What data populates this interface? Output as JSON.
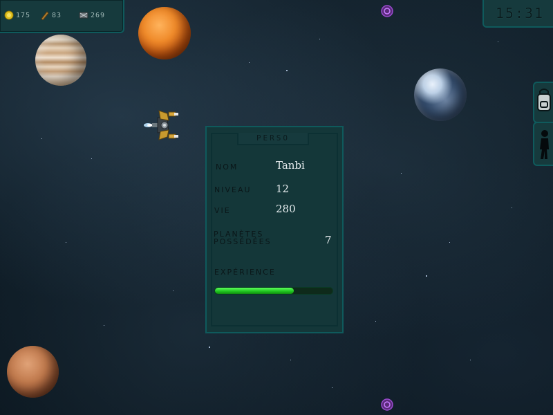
{
  "resources": [
    {
      "icon": "gold-coin-icon",
      "value": "175"
    },
    {
      "icon": "wood-plank-icon",
      "value": "83"
    },
    {
      "icon": "ore-icon",
      "value": "269"
    }
  ],
  "clock": "15:31",
  "sidebar": {
    "backpack_icon": "backpack-icon",
    "character_icon": "character-icon"
  },
  "perso": {
    "title": "PERSO",
    "nom_label": "NOM",
    "nom_value": "Tanbi",
    "niveau_label": "NIVEAU",
    "niveau_value": "12",
    "vie_label": "VIE",
    "vie_value": "280",
    "planetes_label": "PLANÈTES POSSÉDÉES",
    "planetes_value": "7",
    "experience_label": "EXPÉRIENCE",
    "experience_progress": 0.67
  },
  "colors": {
    "panel": "#163a3d",
    "panel_border": "#0f5a5c",
    "xp_bar": "#22c722"
  }
}
